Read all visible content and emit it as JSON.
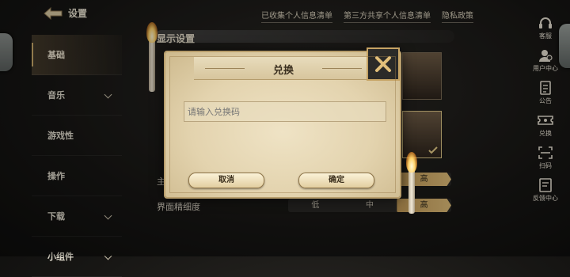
{
  "header": {
    "back_label": "设置"
  },
  "top_links": [
    "已收集个人信息清单",
    "第三方共享个人信息清单",
    "隐私政策"
  ],
  "sidebar": {
    "items": [
      {
        "label": "基础",
        "active": true,
        "has_chevron": false
      },
      {
        "label": "音乐",
        "active": false,
        "has_chevron": true
      },
      {
        "label": "游戏性",
        "active": false,
        "has_chevron": false
      },
      {
        "label": "操作",
        "active": false,
        "has_chevron": false
      },
      {
        "label": "下载",
        "active": false,
        "has_chevron": true
      },
      {
        "label": "小组件",
        "active": false,
        "has_chevron": true
      }
    ]
  },
  "main": {
    "section_title": "显示设置",
    "rows": [
      {
        "label": "主",
        "options": [
          "",
          "",
          "高"
        ],
        "selected": 2
      },
      {
        "label": "界面精细度",
        "options": [
          "低",
          "中",
          "高"
        ],
        "selected": 2
      }
    ]
  },
  "right_rail": {
    "items": [
      {
        "label": "客服",
        "icon": "headset-icon"
      },
      {
        "label": "用户中心",
        "icon": "user-center-icon"
      },
      {
        "label": "公告",
        "icon": "notice-icon"
      },
      {
        "label": "兑换",
        "icon": "ticket-icon"
      },
      {
        "label": "扫码",
        "icon": "scan-icon"
      },
      {
        "label": "反馈中心",
        "icon": "feedback-icon"
      }
    ]
  },
  "dialog": {
    "title": "兑换",
    "input_placeholder": "请输入兑换码",
    "input_value": "",
    "cancel_label": "取消",
    "confirm_label": "确定"
  },
  "colors": {
    "accent_gold": "#e2bf7a",
    "parchment": "#e3d3ae",
    "background": "#171614"
  }
}
